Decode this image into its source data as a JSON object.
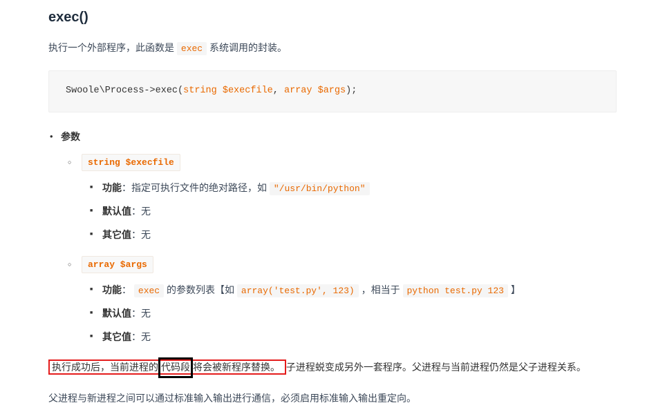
{
  "title": "exec()",
  "intro": {
    "pre": "执行一个外部程序，此函数是 ",
    "code": "exec",
    "post": " 系统调用的封装。"
  },
  "code_sig": {
    "t1": "Swoole\\Process->exec(",
    "kw1": "string",
    "sp1": " ",
    "v1": "$execfile",
    "comma1": ", ",
    "kw2": "array",
    "sp2": " ",
    "v2": "$args",
    "t2": ");"
  },
  "params_heading": "参数",
  "param1": {
    "pill": "string $execfile",
    "fn_label": "功能",
    "fn_text": "：指定可执行文件的绝对路径，如 ",
    "fn_code": "\"/usr/bin/python\"",
    "def_label": "默认值",
    "def_text": "：无",
    "oth_label": "其它值",
    "oth_text": "：无"
  },
  "param2": {
    "pill": "array $args",
    "fn_label": "功能",
    "fn_pre": "： ",
    "fn_code1": "exec",
    "fn_mid": " 的参数列表【如 ",
    "fn_code2": "array('test.py', 123)",
    "fn_mid2": " ，相当于 ",
    "fn_code3": "python test.py 123",
    "fn_post": " 】",
    "def_label": "默认值",
    "def_text": "：无",
    "oth_label": "其它值",
    "oth_text": "：无"
  },
  "para1": {
    "p1": "执行成功后，当前进程的",
    "boxed": "代码段",
    "p2": "将会被新程序替换。",
    "p3": "子进程蜕变成另外一套程序。父进程与当前进程仍然是父子进程关系。"
  },
  "para2": "父进程与新进程之间可以通过标准输入输出进行通信，必须启用标准输入输出重定向。"
}
